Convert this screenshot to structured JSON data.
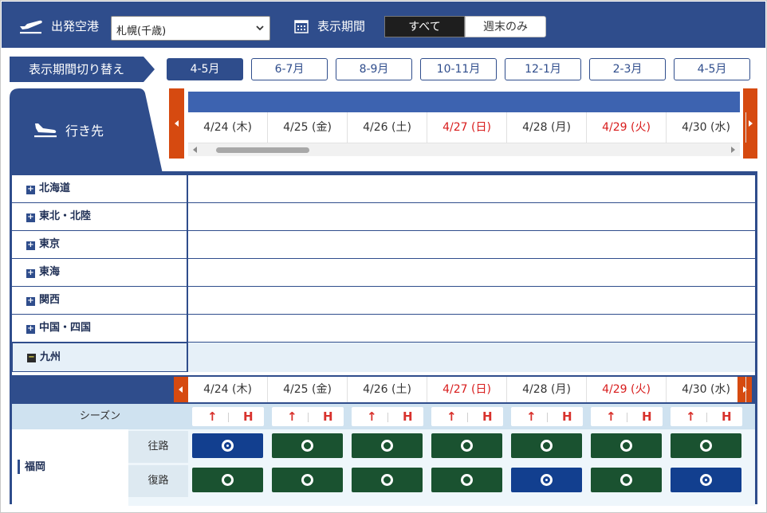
{
  "header": {
    "origin_label": "出発空港",
    "origin_value": "札幌(千歳)",
    "period_label": "表示期間",
    "period_options": [
      "すべて",
      "週末のみ"
    ]
  },
  "period_switch": {
    "label": "表示期間切り替え",
    "tabs": [
      "4-5月",
      "6-7月",
      "8-9月",
      "10-11月",
      "12-1月",
      "2-3月",
      "4-5月"
    ],
    "active_index": 0
  },
  "destination_label": "行き先",
  "dates": [
    {
      "label": "4/24 (木)",
      "holiday": false
    },
    {
      "label": "4/25 (金)",
      "holiday": false
    },
    {
      "label": "4/26 (土)",
      "holiday": false
    },
    {
      "label": "4/27 (日)",
      "holiday": true
    },
    {
      "label": "4/28 (月)",
      "holiday": false
    },
    {
      "label": "4/29 (火)",
      "holiday": true
    },
    {
      "label": "4/30 (水)",
      "holiday": false
    }
  ],
  "regions": [
    {
      "name": "北海道",
      "expanded": false
    },
    {
      "name": "東北・北陸",
      "expanded": false
    },
    {
      "name": "東京",
      "expanded": false
    },
    {
      "name": "東海",
      "expanded": false
    },
    {
      "name": "関西",
      "expanded": false
    },
    {
      "name": "中国・四国",
      "expanded": false
    },
    {
      "name": "九州",
      "expanded": true
    }
  ],
  "kyushu": {
    "season_label": "シーズン",
    "season_marks": {
      "up": "↑",
      "h": "H"
    },
    "city": "福岡",
    "outbound_label": "往路",
    "return_label": "復路",
    "outbound_fares": [
      "blue",
      "green",
      "green",
      "green",
      "green",
      "green",
      "green"
    ],
    "return_fares": [
      "green",
      "green",
      "green",
      "green",
      "blue",
      "green",
      "blue"
    ]
  },
  "colors": {
    "header_navy": "#2f4d8c",
    "accent_orange": "#d64a10",
    "holiday_red": "#d81c1c",
    "fare_green": "#1a5230",
    "fare_blue": "#123f8f"
  }
}
